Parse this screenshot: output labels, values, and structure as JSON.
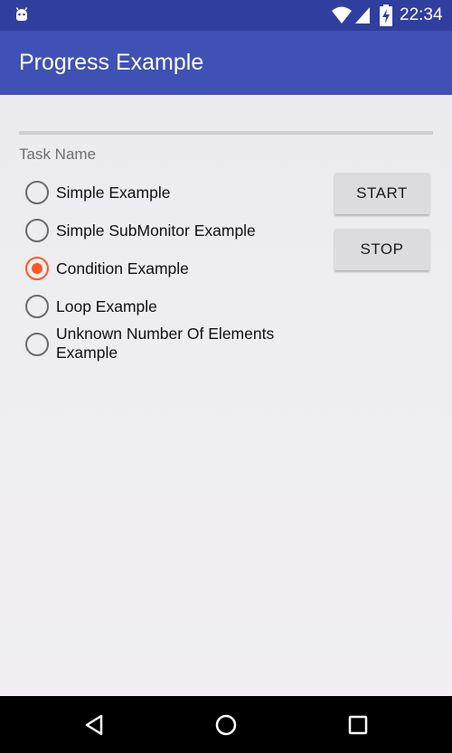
{
  "status_bar": {
    "time": "22:34",
    "icons": [
      "android-icon",
      "wifi-icon",
      "signal-icon",
      "battery-charging-icon"
    ]
  },
  "app_bar": {
    "title": "Progress Example",
    "color": "#3f51b5"
  },
  "progress": {
    "value": 0,
    "accent": "#ff5722"
  },
  "task": {
    "label": "Task Name",
    "options": [
      {
        "label": "Simple Example",
        "checked": false
      },
      {
        "label": "Simple SubMonitor Example",
        "checked": false
      },
      {
        "label": "Condition Example",
        "checked": true
      },
      {
        "label": "Loop Example",
        "checked": false
      },
      {
        "label": "Unknown Number Of Elements Example",
        "checked": false
      }
    ]
  },
  "buttons": {
    "start": "START",
    "stop": "STOP"
  },
  "nav_bar": {
    "icons": [
      "back-icon",
      "home-icon",
      "recents-icon"
    ]
  }
}
